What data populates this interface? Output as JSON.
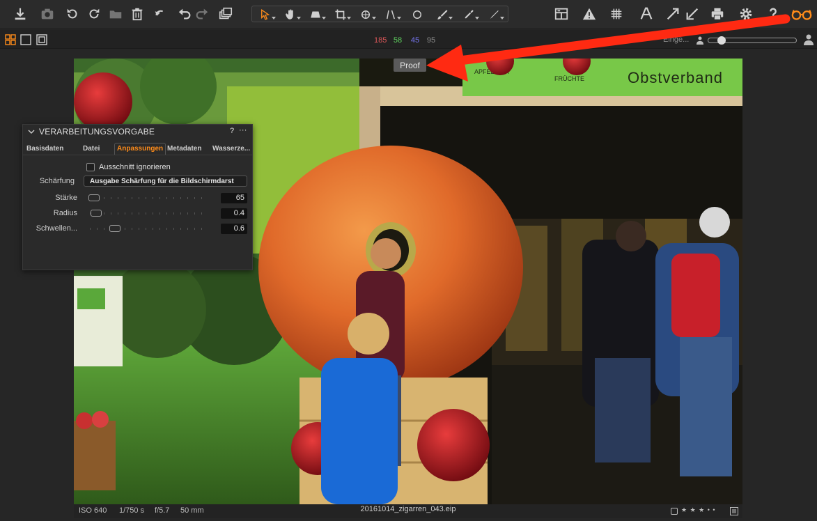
{
  "colors": {
    "accent_orange": "#ff8c1a",
    "histo_red": "#e0585a",
    "histo_green": "#5fd15f",
    "histo_blue": "#7676f0",
    "histo_gray": "#8d8d8d",
    "annotation_red": "#ff2a12"
  },
  "toolbar": {
    "left_icons": [
      "import-icon",
      "camera-icon",
      "rotate-left-icon",
      "rotate-right-icon",
      "move-to-folder-icon",
      "trash-icon",
      "reset-icon",
      "undo-icon",
      "redo-icon",
      "variants-icon"
    ],
    "cursor_tools": [
      "select-arrow-icon",
      "pan-hand-icon",
      "crop-aspect-icon",
      "crop-icon",
      "rotate-straighten-icon",
      "keystone-icon",
      "circle-mask-icon",
      "brush-icon",
      "picker-icon",
      "annotate-icon"
    ],
    "right_icons": [
      "before-after-icon",
      "warning-exposure-icon",
      "grid-icon",
      "text-overlay-icon",
      "expand-arrows-icon",
      "print-icon",
      "settings-gear-icon",
      "help-icon",
      "proof-glasses-icon"
    ]
  },
  "subbar": {
    "histo": {
      "r": "185",
      "g": "58",
      "b": "45",
      "l": "95"
    },
    "input_label": "Einge...",
    "zoom_level": 0.08
  },
  "viewer": {
    "proof_label": "Proof",
    "sign_text": "Obstverband",
    "sign_apfelsaft": "APFELSAFT",
    "sign_fruechte": "FRÜCHTE"
  },
  "statusbar": {
    "iso": "ISO 640",
    "shutter": "1/750 s",
    "aperture": "f/5.7",
    "focal": "50 mm",
    "filename": "20161014_zigarren_043.eip",
    "stars": "★ ★ ★ • •"
  },
  "panel": {
    "title": "VERARBEITUNGSVORGABE",
    "help": "?",
    "more": "···",
    "tabs": [
      "Basisdaten",
      "Datei",
      "Anpassungen",
      "Metadaten",
      "Wasserze..."
    ],
    "active_tab": 2,
    "ignore_crop_label": "Ausschnitt ignorieren",
    "sharpening_label": "Schärfung",
    "sharpening_value": "Ausgabe Schärfung für die Bildschirmdarst",
    "sliders": [
      {
        "label": "Stärke",
        "value": "65"
      },
      {
        "label": "Radius",
        "value": "0.4"
      },
      {
        "label": "Schwellen...",
        "value": "0.6"
      }
    ]
  }
}
